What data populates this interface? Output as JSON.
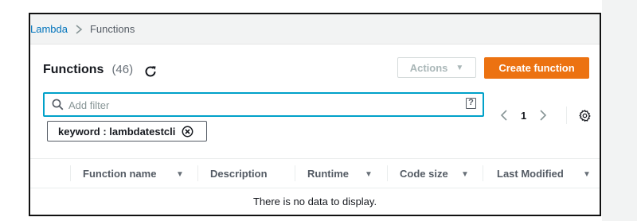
{
  "breadcrumb": {
    "root": "Lambda",
    "current": "Functions"
  },
  "panel": {
    "title": "Functions",
    "count": "(46)"
  },
  "toolbar": {
    "actions_label": "Actions",
    "actions_caret": "▼",
    "create_label": "Create function"
  },
  "search": {
    "placeholder": "Add filter",
    "value": "",
    "help_glyph": "?"
  },
  "filter_token": {
    "label": "keyword : lambdatestcli"
  },
  "pagination": {
    "current_page": "1"
  },
  "table": {
    "columns": [
      {
        "label": "Function name",
        "sortable": true
      },
      {
        "label": "Description",
        "sortable": false
      },
      {
        "label": "Runtime",
        "sortable": true
      },
      {
        "label": "Code size",
        "sortable": true
      },
      {
        "label": "Last Modified",
        "sortable": true
      }
    ],
    "sort_glyph": "▼",
    "empty_message": "There is no data to display."
  },
  "colors": {
    "accent": "#ec7211",
    "link": "#0073bb",
    "focus": "#00a1c9"
  }
}
